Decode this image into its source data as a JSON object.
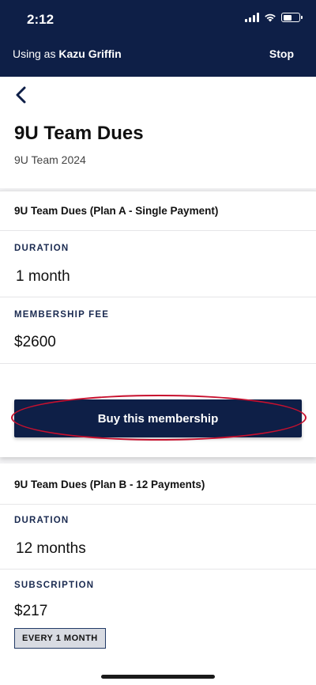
{
  "status_bar": {
    "time": "2:12"
  },
  "impersonation": {
    "prefix": "Using as",
    "user": "Kazu Griffin",
    "stop_label": "Stop"
  },
  "page": {
    "title": "9U Team Dues",
    "subtitle": "9U Team 2024"
  },
  "plans": [
    {
      "name": "9U Team Dues (Plan A - Single Payment)",
      "duration_label": "DURATION",
      "duration_value": "1 month",
      "fee_label": "MEMBERSHIP FEE",
      "fee_value": "$2600",
      "buy_label": "Buy this membership"
    },
    {
      "name": "9U Team Dues (Plan B - 12 Payments)",
      "duration_label": "DURATION",
      "duration_value": "12 months",
      "fee_label": "SUBSCRIPTION",
      "fee_value": "$217",
      "frequency_badge": "EVERY 1 MONTH"
    }
  ],
  "colors": {
    "navy": "#0e1f47",
    "highlight": "#c8102e"
  }
}
